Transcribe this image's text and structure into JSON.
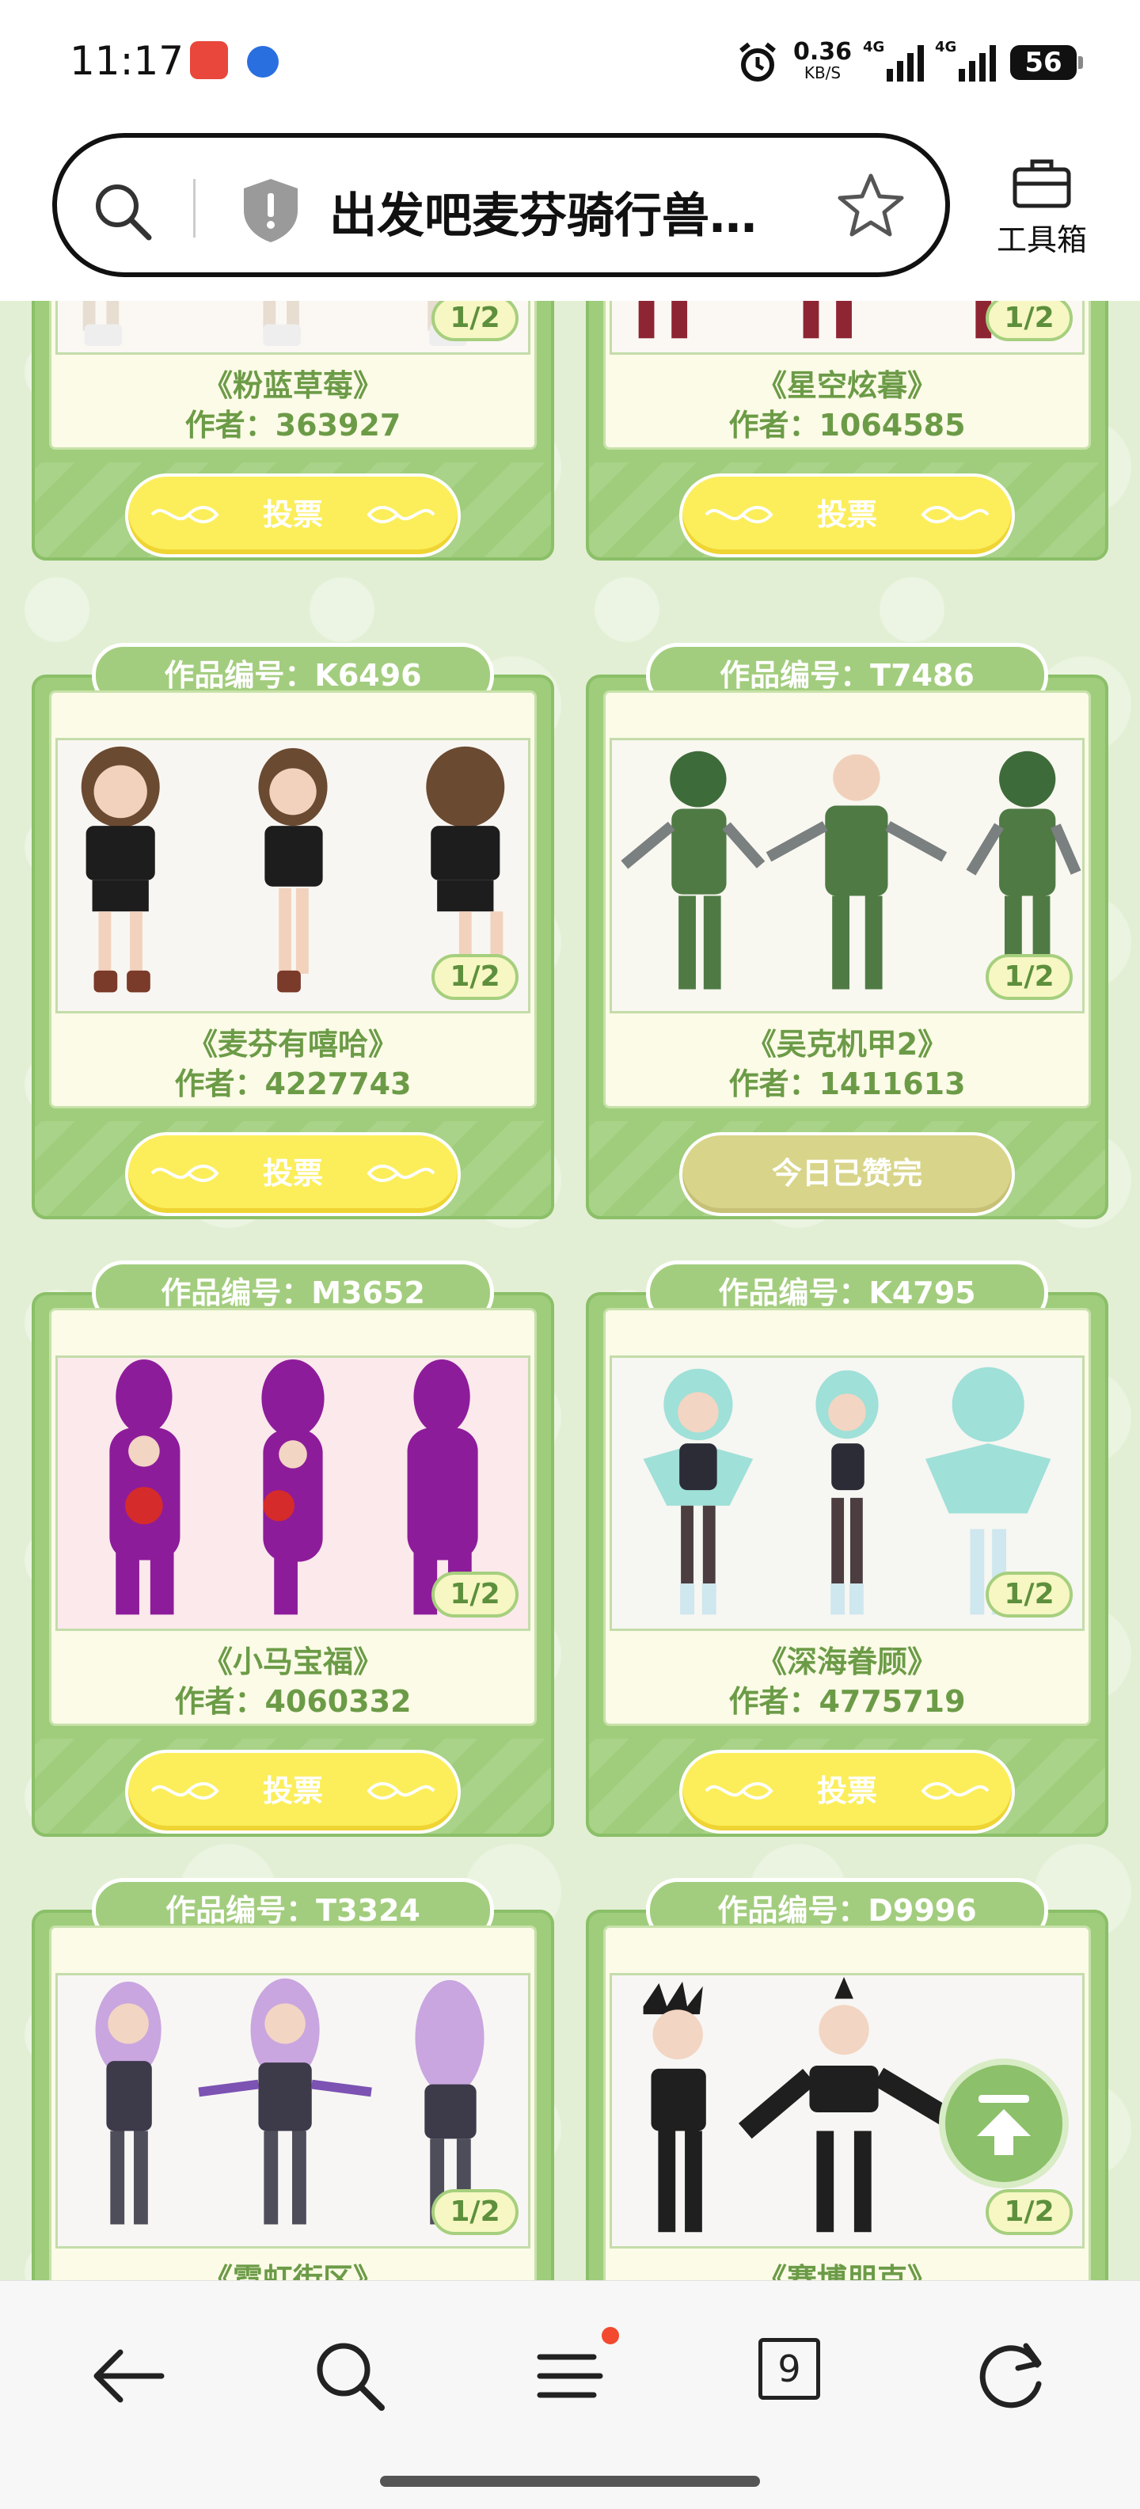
{
  "status_bar": {
    "time": "11:17",
    "net_speed": "0.36",
    "net_unit": "KB/S",
    "sig1_label": "4G",
    "sig2_label": "4G",
    "battery": "56"
  },
  "address_bar": {
    "title": "出发吧麦芬骑行兽…",
    "toolbox_label": "工具箱"
  },
  "cards": [
    {
      "id_label": "",
      "title": "《粉蓝草莓》",
      "author": "作者：363927",
      "page": "1/2",
      "button": "投票"
    },
    {
      "id_label": "",
      "title": "《星空炫暮》",
      "author": "作者：1064585",
      "page": "1/2",
      "button": "投票"
    },
    {
      "id_label": "作品编号：K6496",
      "title": "《麦芬有嘻哈》",
      "author": "作者：4227743",
      "page": "1/2",
      "button": "投票"
    },
    {
      "id_label": "作品编号：T7486",
      "title": "《吴克机甲2》",
      "author": "作者：1411613",
      "page": "1/2",
      "button": "今日已赞完"
    },
    {
      "id_label": "作品编号：M3652",
      "title": "《小马宝福》",
      "author": "作者：4060332",
      "page": "1/2",
      "button": "投票"
    },
    {
      "id_label": "作品编号：K4795",
      "title": "《深海眷顾》",
      "author": "作者：4775719",
      "page": "1/2",
      "button": "投票"
    },
    {
      "id_label": "作品编号：T3324",
      "title": "《霓虹街区》",
      "author": "",
      "page": "1/2",
      "button": ""
    },
    {
      "id_label": "作品编号：D9996",
      "title": "《赛博朋克》",
      "author": "",
      "page": "1/2",
      "button": ""
    }
  ],
  "bottom_nav": {
    "tab_count": "9"
  },
  "colors": {
    "card_green": "#9fcd7c",
    "vote_yellow": "#fbee5a",
    "voted_khaki": "#d8d58a",
    "text_green": "#6c9b47",
    "background": "#e2efd4"
  }
}
